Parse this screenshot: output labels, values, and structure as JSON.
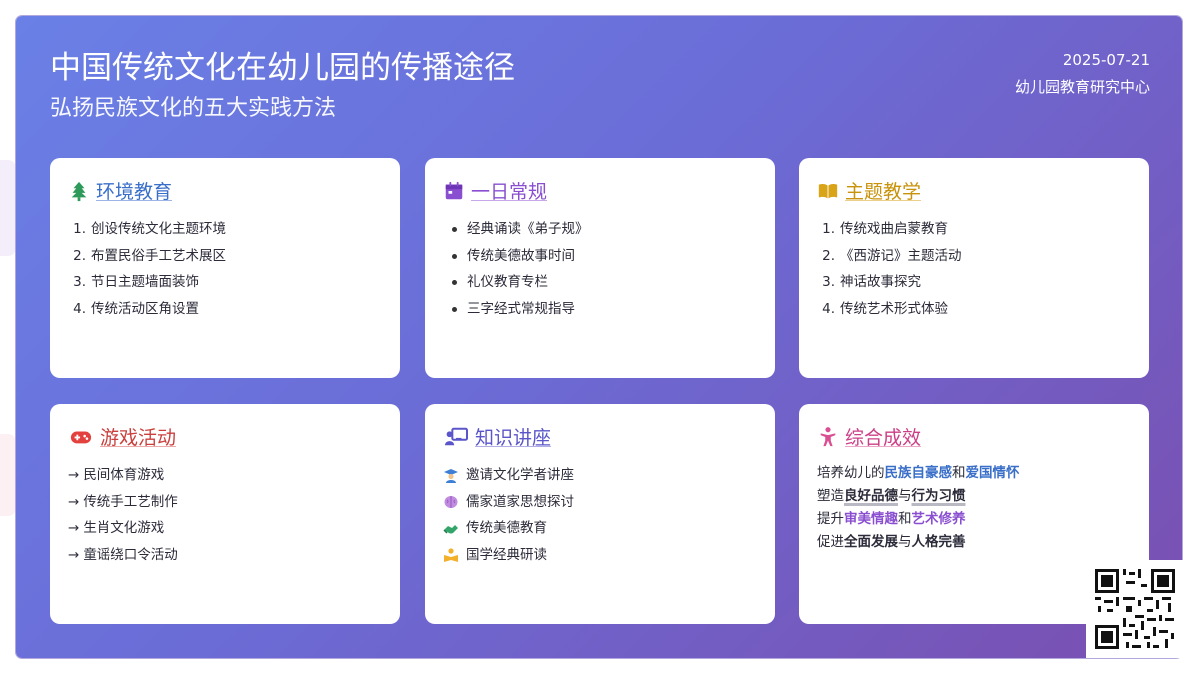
{
  "header": {
    "title": "中国传统文化在幼儿园的传播途径",
    "subtitle": "弘扬民族文化的五大实践方法",
    "date": "2025-07-21",
    "org": "幼儿园教育研究中心"
  },
  "cards": {
    "env": {
      "title": "环境教育",
      "icon": "tree-icon",
      "color": "#3a6fc9",
      "items": [
        "创设传统文化主题环境",
        "布置民俗手工艺术展区",
        "节日主题墙面装饰",
        "传统活动区角设置"
      ]
    },
    "daily": {
      "title": "一日常规",
      "icon": "calendar-icon",
      "color": "#8a4fd0",
      "items": [
        "经典诵读《弟子规》",
        "传统美德故事时间",
        "礼仪教育专栏",
        "三字经式常规指导"
      ]
    },
    "theme": {
      "title": "主题教学",
      "icon": "book-icon",
      "color": "#c8920a",
      "items": [
        "传统戏曲启蒙教育",
        "《西游记》主题活动",
        "神话故事探究",
        "传统艺术形式体验"
      ]
    },
    "game": {
      "title": "游戏活动",
      "icon": "gamepad-icon",
      "color": "#c9403d",
      "items": [
        "民间体育游戏",
        "传统手工艺制作",
        "生肖文化游戏",
        "童谣绕口令活动"
      ]
    },
    "lecture": {
      "title": "知识讲座",
      "icon": "teacher-icon",
      "color": "#5a55c8",
      "items": [
        "邀请文化学者讲座",
        "儒家道家思想探讨",
        "传统美德教育",
        "国学经典研读"
      ],
      "item_icons": [
        "scholar-icon",
        "brain-icon",
        "handshake-icon",
        "reading-icon"
      ]
    },
    "result": {
      "title": "综合成效",
      "icon": "child-icon",
      "color": "#cc3f86",
      "lines": [
        {
          "pre": "培养幼儿的",
          "k1": "民族自豪感",
          "mid": "和",
          "k2": "爱国情怀"
        },
        {
          "pre": "塑造",
          "k1": "良好品德",
          "mid": "与",
          "k2": "行为习惯"
        },
        {
          "pre": "提升",
          "k1": "审美情趣",
          "mid": "和",
          "k2": "艺术修养"
        },
        {
          "pre": "促进",
          "k1": "全面发展",
          "mid": "与",
          "k2": "人格完善"
        }
      ]
    }
  },
  "colors": {
    "blue": "#3a6fc9",
    "purple": "#8a4fd0",
    "gold": "#c8920a",
    "red": "#c9403d",
    "indigo": "#5a55c8",
    "pink": "#cc3f86"
  }
}
